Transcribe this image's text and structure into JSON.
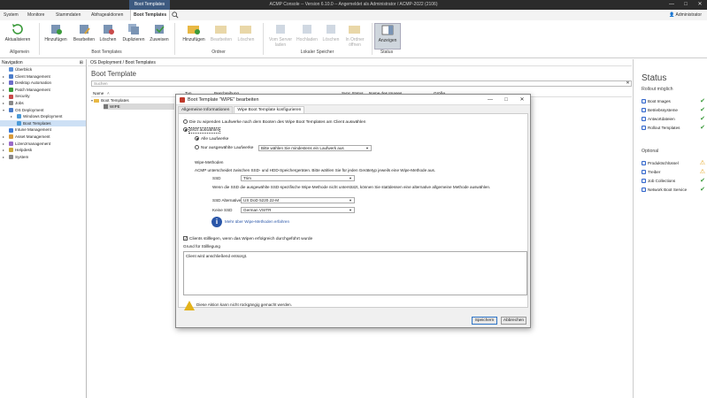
{
  "window": {
    "contextual_tab": "Boot Templates",
    "title": "ACMP Console -- Version 6.10.0 -- Angemeldet als Administrator / ACMP-2022 (2106)",
    "controls": [
      "—",
      "□",
      "✕"
    ]
  },
  "menu": {
    "tabs": [
      "System",
      "Monitore",
      "Stammdaten",
      "Abfrageaktionen",
      "Boot Templates"
    ],
    "active_tab": "Boot Templates",
    "user": "Administrator"
  },
  "ribbon": {
    "buttons": {
      "aktualisieren": "Aktualisieren",
      "hinzufuegen": "Hinzufügen",
      "bearbeiten": "Bearbeiten",
      "loeschen": "Löschen",
      "duplizieren": "Duplizieren",
      "zuweisen": "Zuweisen",
      "o_hinzufuegen": "Hinzufügen",
      "o_bearbeiten": "Bearbeiten",
      "o_loeschen": "Löschen",
      "vom_server_laden": "Vom Server laden",
      "hochladen": "Hochladen",
      "l_loeschen": "Löschen",
      "in_ordner_oeffnen": "In Ordner öffnen",
      "anzeigen": "Anzeigen"
    },
    "groups": {
      "allgemein": "Allgemein",
      "boot_templates": "Boot Templates",
      "ordner": "Ordner",
      "lokaler_speicher": "Lokaler Speicher",
      "status": "Status"
    }
  },
  "navigation": {
    "header": "Navigation",
    "items": [
      {
        "label": "Überblick",
        "color": "#5a8fd8"
      },
      {
        "label": "Client Management",
        "color": "#4a7cc9"
      },
      {
        "label": "Desktop Automation",
        "color": "#6c6cc9"
      },
      {
        "label": "Patch Management",
        "color": "#3a9a3a"
      },
      {
        "label": "Security",
        "color": "#c94a4a"
      },
      {
        "label": "Jobs",
        "color": "#888888"
      },
      {
        "label": "OS Deployment",
        "color": "#4a7cc9"
      },
      {
        "label": "Windows Deployment",
        "color": "#4a9ad8"
      },
      {
        "label": "Boot Templates",
        "color": "#4a9ad8"
      },
      {
        "label": "Intune Management",
        "color": "#3a7ad8"
      },
      {
        "label": "Asset Management",
        "color": "#d89a3a"
      },
      {
        "label": "Lizenzmanagement",
        "color": "#9a6ac9"
      },
      {
        "label": "Helpdesk",
        "color": "#c9a83a"
      },
      {
        "label": "System",
        "color": "#888888"
      }
    ]
  },
  "breadcrumb": "OS Deployment / Boot Templates",
  "content": {
    "title": "Boot Template",
    "search_placeholder": "Suchen",
    "columns": [
      "Name",
      "Typ",
      "Beschreibung",
      "Sync Status",
      "Name des Images",
      "Größe"
    ],
    "rows": [
      {
        "label": "Boot Templates"
      },
      {
        "label": "WIPE"
      }
    ]
  },
  "status_panel": {
    "title": "Status",
    "rollout_heading": "Rollout möglich",
    "rollout_items": [
      {
        "label": "Boot Images",
        "state": "ok"
      },
      {
        "label": "Betriebssysteme",
        "state": "ok"
      },
      {
        "label": "Antwortdateien",
        "state": "ok"
      },
      {
        "label": "Rollout Templates",
        "state": "ok"
      }
    ],
    "optional_heading": "Optional",
    "optional_items": [
      {
        "label": "Produktschlüssel",
        "state": "warn"
      },
      {
        "label": "Treiber",
        "state": "warn"
      },
      {
        "label": "Job Collections",
        "state": "ok"
      },
      {
        "label": "Network Boot Service",
        "state": "ok"
      }
    ],
    "colors": {
      "ok": "#3a9a3a",
      "warn": "#e3a21a"
    }
  },
  "dialog": {
    "title": "Boot Template \"WIPE\" bearbeiten",
    "tabs": [
      "Allgemeine Informationen",
      "Wipe Boot Template konfigurieren"
    ],
    "active_tab": "Wipe Boot Template konfigurieren",
    "radio_client_choose": "Die zu wipenden Laufwerke nach dem Booten des Wipe Boot Templates am Client auswählen",
    "radio_now_choose": "Jetzt auswählen",
    "radio_all_drives": "Alle Laufwerke",
    "radio_selected_drives": "Nur ausgewählte Laufwerke",
    "drive_select_placeholder": "Bitte wählen Sie mindestens ein Laufwerk aus",
    "wipe_methods_heading": "Wipe-Methoden",
    "wipe_methods_desc": "ACMP unterscheidet zwischen SSD- und HDD-Speichergeräten. Bitte wählen Sie für jeden Gerätetyp jeweils eine Wipe-Methode aus.",
    "ssd_label": "SSD",
    "ssd_value": "Trim",
    "ssd_note": "Wenn die SSD die ausgewählte SSD-spezifische Wipe-Methode nicht unterstützt, können Sie stattdessen eine alternative allgemeine Methode auswählen.",
    "ssd_alt_label": "SSD Alternative",
    "ssd_alt_value": "US DoD 5220.22-M",
    "no_ssd_label": "Keine SSD",
    "no_ssd_value": "German VSITR",
    "more_info_link": "Mehr über Wipe-Methoden erfahren",
    "shutdown_checkbox": "Clients stilllegen, wenn das Wipen erfolgreich durchgeführt wurde",
    "shutdown_checked": true,
    "reason_label": "Grund für Stilllegung",
    "reason_value": "Client wird anschließend entsorgt.",
    "warning_text": "Diese Aktion kann nicht rückgängig gemacht werden.",
    "save_button": "Speichern",
    "cancel_button": "Abbrechen"
  }
}
